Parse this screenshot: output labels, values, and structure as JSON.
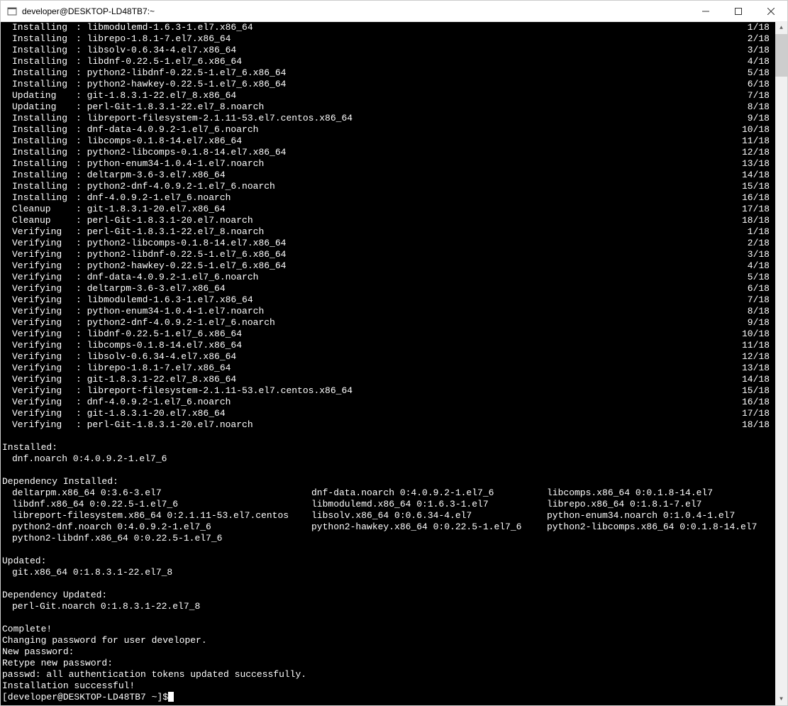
{
  "window": {
    "title": "developer@DESKTOP-LD48TB7:~"
  },
  "steps": [
    {
      "action": "Installing",
      "pkg": ": libmodulemd-1.6.3-1.el7.x86_64",
      "count": "1/18"
    },
    {
      "action": "Installing",
      "pkg": ": librepo-1.8.1-7.el7.x86_64",
      "count": "2/18"
    },
    {
      "action": "Installing",
      "pkg": ": libsolv-0.6.34-4.el7.x86_64",
      "count": "3/18"
    },
    {
      "action": "Installing",
      "pkg": ": libdnf-0.22.5-1.el7_6.x86_64",
      "count": "4/18"
    },
    {
      "action": "Installing",
      "pkg": ": python2-libdnf-0.22.5-1.el7_6.x86_64",
      "count": "5/18"
    },
    {
      "action": "Installing",
      "pkg": ": python2-hawkey-0.22.5-1.el7_6.x86_64",
      "count": "6/18"
    },
    {
      "action": "Updating",
      "pkg": ": git-1.8.3.1-22.el7_8.x86_64",
      "count": "7/18"
    },
    {
      "action": "Updating",
      "pkg": ": perl-Git-1.8.3.1-22.el7_8.noarch",
      "count": "8/18"
    },
    {
      "action": "Installing",
      "pkg": ": libreport-filesystem-2.1.11-53.el7.centos.x86_64",
      "count": "9/18"
    },
    {
      "action": "Installing",
      "pkg": ": dnf-data-4.0.9.2-1.el7_6.noarch",
      "count": "10/18"
    },
    {
      "action": "Installing",
      "pkg": ": libcomps-0.1.8-14.el7.x86_64",
      "count": "11/18"
    },
    {
      "action": "Installing",
      "pkg": ": python2-libcomps-0.1.8-14.el7.x86_64",
      "count": "12/18"
    },
    {
      "action": "Installing",
      "pkg": ": python-enum34-1.0.4-1.el7.noarch",
      "count": "13/18"
    },
    {
      "action": "Installing",
      "pkg": ": deltarpm-3.6-3.el7.x86_64",
      "count": "14/18"
    },
    {
      "action": "Installing",
      "pkg": ": python2-dnf-4.0.9.2-1.el7_6.noarch",
      "count": "15/18"
    },
    {
      "action": "Installing",
      "pkg": ": dnf-4.0.9.2-1.el7_6.noarch",
      "count": "16/18"
    },
    {
      "action": "Cleanup",
      "pkg": ": git-1.8.3.1-20.el7.x86_64",
      "count": "17/18"
    },
    {
      "action": "Cleanup",
      "pkg": ": perl-Git-1.8.3.1-20.el7.noarch",
      "count": "18/18"
    },
    {
      "action": "Verifying",
      "pkg": ": perl-Git-1.8.3.1-22.el7_8.noarch",
      "count": "1/18"
    },
    {
      "action": "Verifying",
      "pkg": ": python2-libcomps-0.1.8-14.el7.x86_64",
      "count": "2/18"
    },
    {
      "action": "Verifying",
      "pkg": ": python2-libdnf-0.22.5-1.el7_6.x86_64",
      "count": "3/18"
    },
    {
      "action": "Verifying",
      "pkg": ": python2-hawkey-0.22.5-1.el7_6.x86_64",
      "count": "4/18"
    },
    {
      "action": "Verifying",
      "pkg": ": dnf-data-4.0.9.2-1.el7_6.noarch",
      "count": "5/18"
    },
    {
      "action": "Verifying",
      "pkg": ": deltarpm-3.6-3.el7.x86_64",
      "count": "6/18"
    },
    {
      "action": "Verifying",
      "pkg": ": libmodulemd-1.6.3-1.el7.x86_64",
      "count": "7/18"
    },
    {
      "action": "Verifying",
      "pkg": ": python-enum34-1.0.4-1.el7.noarch",
      "count": "8/18"
    },
    {
      "action": "Verifying",
      "pkg": ": python2-dnf-4.0.9.2-1.el7_6.noarch",
      "count": "9/18"
    },
    {
      "action": "Verifying",
      "pkg": ": libdnf-0.22.5-1.el7_6.x86_64",
      "count": "10/18"
    },
    {
      "action": "Verifying",
      "pkg": ": libcomps-0.1.8-14.el7.x86_64",
      "count": "11/18"
    },
    {
      "action": "Verifying",
      "pkg": ": libsolv-0.6.34-4.el7.x86_64",
      "count": "12/18"
    },
    {
      "action": "Verifying",
      "pkg": ": librepo-1.8.1-7.el7.x86_64",
      "count": "13/18"
    },
    {
      "action": "Verifying",
      "pkg": ": git-1.8.3.1-22.el7_8.x86_64",
      "count": "14/18"
    },
    {
      "action": "Verifying",
      "pkg": ": libreport-filesystem-2.1.11-53.el7.centos.x86_64",
      "count": "15/18"
    },
    {
      "action": "Verifying",
      "pkg": ": dnf-4.0.9.2-1.el7_6.noarch",
      "count": "16/18"
    },
    {
      "action": "Verifying",
      "pkg": ": git-1.8.3.1-20.el7.x86_64",
      "count": "17/18"
    },
    {
      "action": "Verifying",
      "pkg": ": perl-Git-1.8.3.1-20.el7.noarch",
      "count": "18/18"
    }
  ],
  "installed_header": "Installed:",
  "installed": "dnf.noarch 0:4.0.9.2-1.el7_6",
  "dep_installed_header": "Dependency Installed:",
  "dep_rows": [
    {
      "c1": "deltarpm.x86_64 0:3.6-3.el7",
      "c2": "dnf-data.noarch 0:4.0.9.2-1.el7_6",
      "c3": "libcomps.x86_64 0:0.1.8-14.el7"
    },
    {
      "c1": "libdnf.x86_64 0:0.22.5-1.el7_6",
      "c2": "libmodulemd.x86_64 0:1.6.3-1.el7",
      "c3": "librepo.x86_64 0:1.8.1-7.el7"
    },
    {
      "c1": "libreport-filesystem.x86_64 0:2.1.11-53.el7.centos",
      "c2": "libsolv.x86_64 0:0.6.34-4.el7",
      "c3": "python-enum34.noarch 0:1.0.4-1.el7"
    },
    {
      "c1": "python2-dnf.noarch 0:4.0.9.2-1.el7_6",
      "c2": "python2-hawkey.x86_64 0:0.22.5-1.el7_6",
      "c3": "python2-libcomps.x86_64 0:0.1.8-14.el7"
    },
    {
      "c1": "python2-libdnf.x86_64 0:0.22.5-1.el7_6",
      "c2": "",
      "c3": ""
    }
  ],
  "updated_header": "Updated:",
  "updated": "git.x86_64 0:1.8.3.1-22.el7_8",
  "dep_updated_header": "Dependency Updated:",
  "dep_updated": "perl-Git.noarch 0:1.8.3.1-22.el7_8",
  "tail": [
    "Complete!",
    "Changing password for user developer.",
    "New password:",
    "Retype new password:",
    "passwd: all authentication tokens updated successfully.",
    "Installation successful!"
  ],
  "prompt": "[developer@DESKTOP-LD48TB7 ~]$"
}
